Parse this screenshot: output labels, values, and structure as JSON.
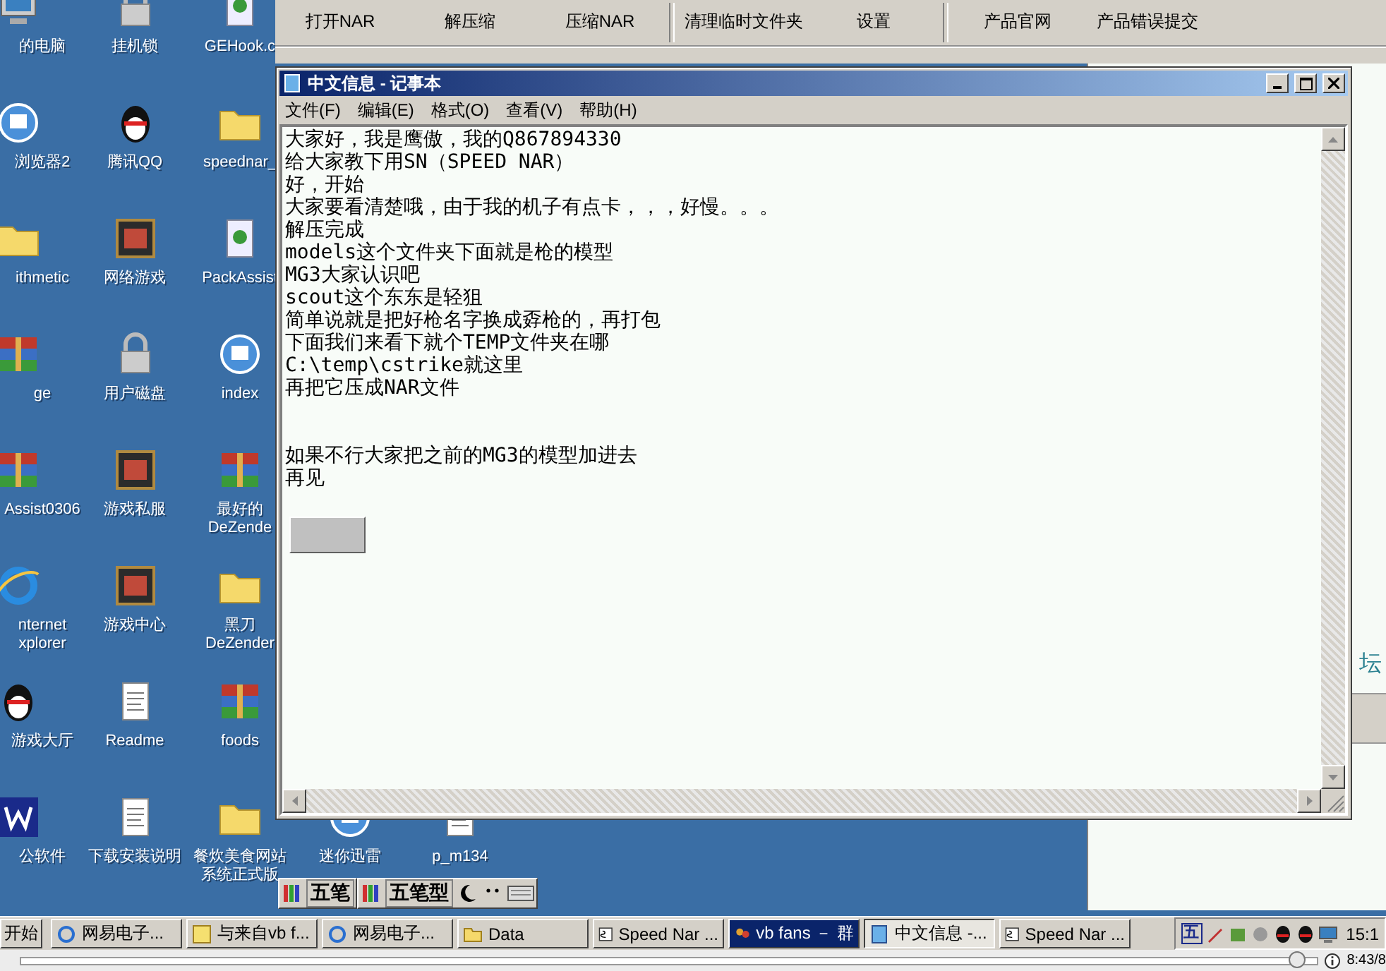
{
  "desktop_icons": [
    [
      {
        "lines": [
          "的电脑"
        ],
        "kind": "computer"
      },
      {
        "lines": [
          "挂机锁"
        ],
        "kind": "lock"
      },
      {
        "lines": [
          "GEHook.c"
        ],
        "kind": "app"
      }
    ],
    [
      {
        "lines": [
          "浏览器2"
        ],
        "kind": "browser"
      },
      {
        "lines": [
          "腾讯QQ"
        ],
        "kind": "penguin"
      },
      {
        "lines": [
          "speednar_"
        ],
        "kind": "folder"
      }
    ],
    [
      {
        "lines": [
          "ithmetic"
        ],
        "kind": "folder"
      },
      {
        "lines": [
          "网络游戏"
        ],
        "kind": "game"
      },
      {
        "lines": [
          "PackAssist"
        ],
        "kind": "app"
      }
    ],
    [
      {
        "lines": [
          "ge"
        ],
        "kind": "archive"
      },
      {
        "lines": [
          "用户磁盘"
        ],
        "kind": "lock"
      },
      {
        "lines": [
          "index"
        ],
        "kind": "browser"
      }
    ],
    [
      {
        "lines": [
          "Assist0306"
        ],
        "kind": "archive"
      },
      {
        "lines": [
          "游戏私服"
        ],
        "kind": "game"
      },
      {
        "lines": [
          "最好的",
          "DeZende"
        ],
        "kind": "archive"
      }
    ],
    [
      {
        "lines": [
          "nternet",
          "xplorer"
        ],
        "kind": "ie"
      },
      {
        "lines": [
          "游戏中心"
        ],
        "kind": "game"
      },
      {
        "lines": [
          "黑刀",
          "DeZender"
        ],
        "kind": "folder"
      }
    ],
    [
      {
        "lines": [
          "游戏大厅"
        ],
        "kind": "penguin"
      },
      {
        "lines": [
          "Readme"
        ],
        "kind": "document"
      },
      {
        "lines": [
          "foods"
        ],
        "kind": "archive"
      }
    ],
    [
      {
        "lines": [
          "公软件"
        ],
        "kind": "word"
      },
      {
        "lines": [
          "下载安装说明"
        ],
        "kind": "document"
      },
      {
        "lines": [
          "餐炊美食网站",
          "系统正式版"
        ],
        "kind": "folder"
      },
      {
        "lines": [
          "迷你迅雷"
        ],
        "kind": "browser"
      },
      {
        "lines": [
          "p_m134"
        ],
        "kind": "document"
      }
    ]
  ],
  "background_app": {
    "toolbar_groups": [
      [
        "打开NAR",
        "解压缩",
        "压缩NAR"
      ],
      [
        "清理临时文件夹",
        "设置"
      ],
      [
        "产品官网",
        "产品错误提交"
      ]
    ],
    "side_text": "坛"
  },
  "notepad": {
    "title": "中文信息 - 记事本",
    "menu": [
      "文件(F)",
      "编辑(E)",
      "格式(O)",
      "查看(V)",
      "帮助(H)"
    ],
    "paragraphs": [
      [
        "大家好，我是鹰傲，我的Q867894330",
        "给大家教下用SN（SPEED NAR）",
        "好，开始",
        "大家要看清楚哦，由于我的机子有点卡，，，好慢。。。",
        "解压完成",
        "models这个文件夹下面就是枪的模型",
        "MG3大家认识吧",
        "scout这个东东是轻狙",
        "简单说就是把好枪名字换成孬枪的，再打包",
        "下面我们来看下就个TEMP文件夹在哪",
        "C:\\temp\\cstrike就这里",
        "再把它压成NAR文件"
      ],
      [
        "如果不行大家把之前的MG3的模型加进去",
        "再见"
      ]
    ]
  },
  "ime_bars": [
    {
      "label": "五笔"
    },
    {
      "label": "五笔型"
    }
  ],
  "taskbar": {
    "start": "开始",
    "tasks": [
      {
        "label": "网易电子...",
        "kind": "ie",
        "selected": false,
        "flashing": false
      },
      {
        "label": "与来自vb f...",
        "kind": "vip",
        "selected": false,
        "flashing": false
      },
      {
        "label": "网易电子...",
        "kind": "ie",
        "selected": false,
        "flashing": false
      },
      {
        "label": "Data",
        "kind": "folder",
        "selected": false,
        "flashing": false
      },
      {
        "label": "Speed Nar ...",
        "kind": "sn",
        "selected": false,
        "flashing": false
      },
      {
        "label": "vb fans － 群",
        "kind": "group",
        "selected": false,
        "flashing": true
      },
      {
        "label": "中文信息 -...",
        "kind": "notepad",
        "selected": true,
        "flashing": false
      },
      {
        "label": "Speed Nar ...",
        "kind": "sn",
        "selected": false,
        "flashing": false
      }
    ],
    "tray_ime": "五",
    "clock": "15:1"
  },
  "player": {
    "level": 0.985,
    "time": "8:43/8"
  }
}
